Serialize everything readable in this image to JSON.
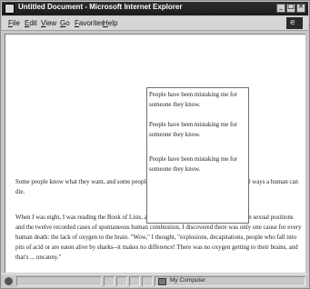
{
  "window": {
    "title": "Untitled Document - Microsoft Internet Explorer",
    "buttons": [
      "minimize-icon",
      "maximize-icon",
      "close-icon"
    ]
  },
  "menubar": {
    "items": [
      "File",
      "Edit",
      "View",
      "Go",
      "Favorites",
      "Help"
    ]
  },
  "content": {
    "paragraph1": "Some people know what they want, and some people know what they need, and I know 1,300 ways a human can die.",
    "paragraph2": "When I was eight, I was reading the Book of Lists, and there among the ten favorite American sexual positions and the twelve recorded cases of spontaneous human combustion, I discovered there was only one cause for every human death: the lack of oxygen to the brain. \"Wow,\" I thought, \"explosions, decapitations, people who fall into pits of acid or are eaten alive by sharks--it makes no difference! There was no oxygen getting to their brains, and that's ... uncanny.\"",
    "box_lines": [
      "People have been mistaking me for someone they know.",
      "People have been mistaking me for someone they know.",
      "People have been mistaking me for someone they know."
    ]
  },
  "statusbar": {
    "zone": "My Computer"
  }
}
